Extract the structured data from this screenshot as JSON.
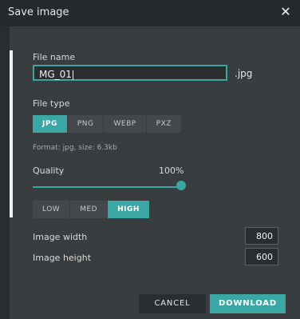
{
  "dialog": {
    "title": "Save image",
    "close_icon": "close-icon"
  },
  "file": {
    "name_label": "File name",
    "name_value": "MG_01",
    "extension": ".jpg"
  },
  "filetype": {
    "label": "File type",
    "options": [
      "JPG",
      "PNG",
      "WEBP",
      "PXZ"
    ],
    "selected": "JPG",
    "format_note": "Format: jpg, size: 6.3kb"
  },
  "quality": {
    "label": "Quality",
    "value_text": "100%",
    "value": 1.0,
    "options": [
      "LOW",
      "MED",
      "HIGH"
    ],
    "selected": "HIGH"
  },
  "dimensions": {
    "width_label": "Image width",
    "width_value": "800",
    "height_label": "Image height",
    "height_value": "600"
  },
  "actions": {
    "cancel": "CANCEL",
    "download": "DOWNLOAD"
  },
  "colors": {
    "accent": "#3aa7a5",
    "background": "#3a3d3f",
    "titlebar": "#26292b"
  }
}
